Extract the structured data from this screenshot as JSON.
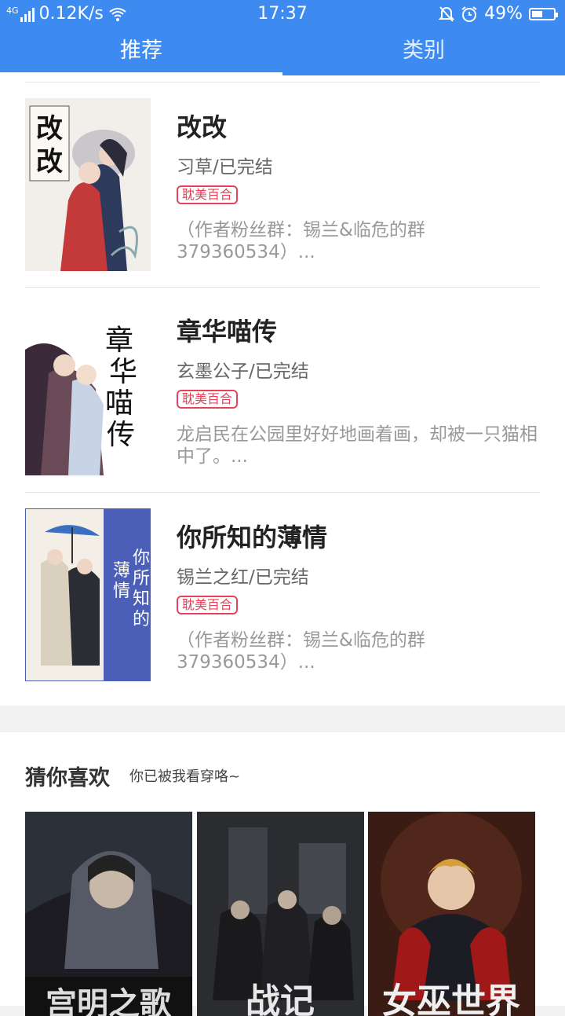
{
  "status_bar": {
    "network": "4G",
    "speed": "0.12K/s",
    "time": "17:37",
    "battery": "49%",
    "battery_level": 0.49
  },
  "tabs": [
    {
      "label": "推荐",
      "active": true
    },
    {
      "label": "类别",
      "active": false
    }
  ],
  "books": [
    {
      "title": "改改",
      "meta": "习草/已完结",
      "tag": "耽美百合",
      "desc": "（作者粉丝群：锡兰&临危的群379360534）...",
      "cover_text": "改改"
    },
    {
      "title": "章华喵传",
      "meta": "玄墨公子/已完结",
      "tag": "耽美百合",
      "desc": "龙启民在公园里好好地画着画，却被一只猫相中了。...",
      "cover_text": "章华喵传"
    },
    {
      "title": "你所知的薄情",
      "meta": "锡兰之红/已完结",
      "tag": "耽美百合",
      "desc": "（作者粉丝群：锡兰&临危的群379360534）...",
      "cover_text": "你所知的薄情"
    }
  ],
  "guess": {
    "title": "猜你喜欢",
    "subtitle": "你已被我看穿咯~"
  },
  "recommendations": [
    {
      "cover_text": "宫明之歌"
    },
    {
      "cover_text": "战记"
    },
    {
      "cover_text": "女巫世界"
    }
  ],
  "colors": {
    "primary": "#3d8af0",
    "tag": "#e8425a"
  }
}
